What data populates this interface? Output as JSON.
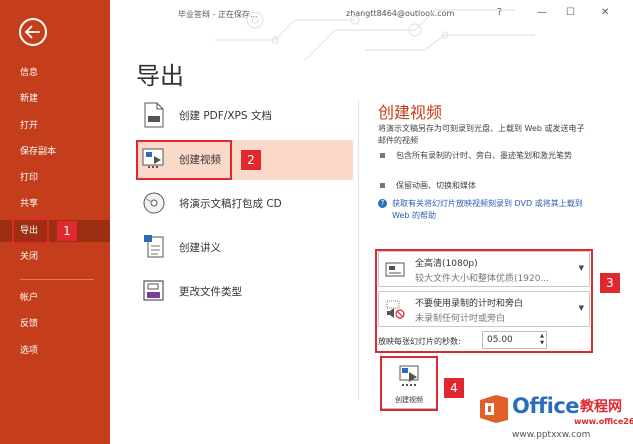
{
  "window": {
    "title": "毕业答辩 - 正在保存...",
    "account": "zhangtt8464@outlook.com",
    "help": "?",
    "minimize": "—",
    "maximize": "☐",
    "close": "✕"
  },
  "sidebar": {
    "items": [
      {
        "label": "信息"
      },
      {
        "label": "新建"
      },
      {
        "label": "打开"
      },
      {
        "label": "保存副本"
      },
      {
        "label": "打印"
      },
      {
        "label": "共享"
      },
      {
        "label": "导出"
      },
      {
        "label": "关闭"
      },
      {
        "label": "帐户"
      },
      {
        "label": "反馈"
      },
      {
        "label": "选项"
      }
    ]
  },
  "page_title": "导出",
  "options": [
    {
      "label": "创建 PDF/XPS 文档",
      "icon": "pdf-icon"
    },
    {
      "label": "创建视频",
      "icon": "video-icon"
    },
    {
      "label": "将演示文稿打包成 CD",
      "icon": "cd-icon"
    },
    {
      "label": "创建讲义",
      "icon": "handout-icon"
    },
    {
      "label": "更改文件类型",
      "icon": "file-type-icon"
    }
  ],
  "panel": {
    "title": "创建视频",
    "description": "将演示文稿另存为可刻录到光盘、上载到 Web 或发送电子邮件的视频",
    "bullets": [
      "包含所有录制的计时、旁白、墨迹笔划和激光笔势",
      "保留动画、切换和媒体"
    ],
    "help_link": "获取有关将幻灯片放映视频刻录到 DVD 或将其上载到 Web 的帮助",
    "quality": {
      "title": "全高清(1080p)",
      "subtitle": "较大文件大小和整体优质(1920..."
    },
    "timing": {
      "title": "不要使用录制的计时和旁白",
      "subtitle": "未录制任何计时或旁白"
    },
    "seconds_label": "放映每张幻灯片的秒数:",
    "seconds_value": "05.00",
    "create_button": "创建视频"
  },
  "callouts": [
    "1",
    "2",
    "3",
    "4"
  ],
  "watermark": {
    "brand": "Office",
    "brand_suffix": "教程网",
    "site": "www.office26.com",
    "url": "www.pptxxw.com"
  },
  "colors": {
    "accent": "#c43e1c",
    "callout": "#e0282f",
    "selected": "#fbd9c8",
    "link": "#2a5fb0"
  }
}
